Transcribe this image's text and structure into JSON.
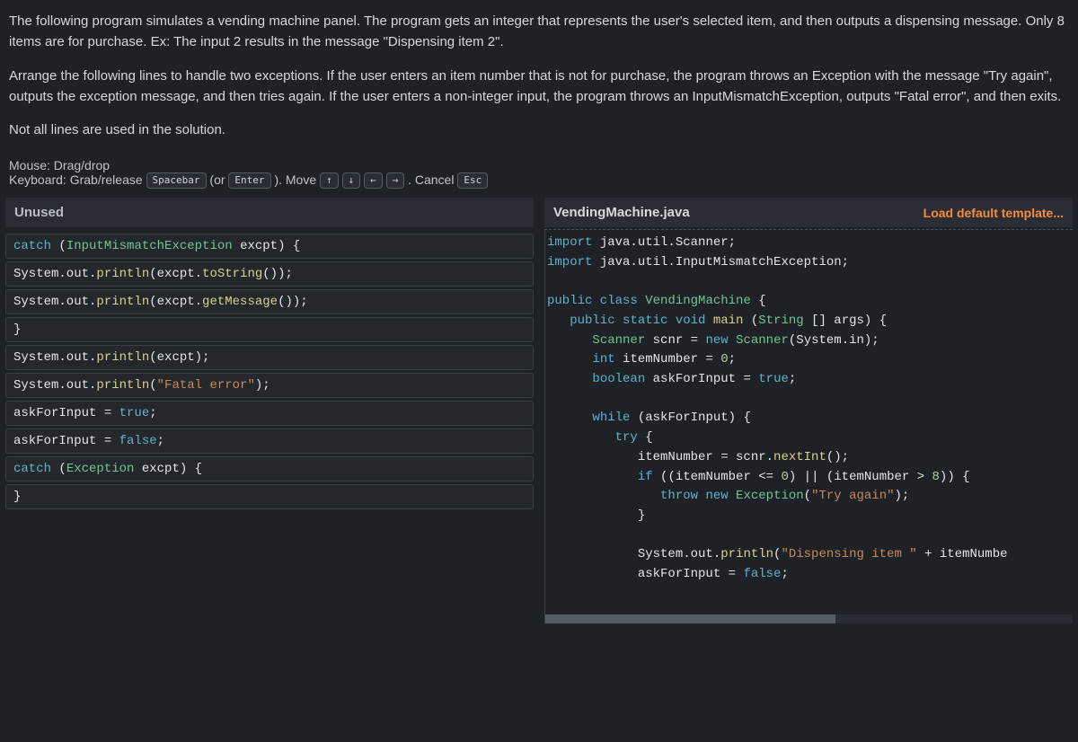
{
  "instructions": {
    "p1": "The following program simulates a vending machine panel. The program gets an integer that represents the user's selected item, and then outputs a dispensing message. Only 8 items are for purchase. Ex: The input 2 results in the message \"Dispensing item 2\".",
    "p2": "Arrange the following lines to handle two exceptions. If the user enters an item number that is not for purchase, the program throws an Exception with the message \"Try again\", outputs the exception message, and then tries again. If the user enters a non-integer input, the program throws an InputMismatchException, outputs \"Fatal error\", and then exits.",
    "p3": "Not all lines are used in the solution."
  },
  "controls": {
    "mouse_label": "Mouse: Drag/drop",
    "kb_prefix": "Keyboard: Grab/release",
    "spacebar": "Spacebar",
    "or": "(or",
    "enter": "Enter",
    "close_paren": ").",
    "move": "Move",
    "up": "↑",
    "down": "↓",
    "left": "←",
    "right": "→",
    "period": ".",
    "cancel": "Cancel",
    "esc": "Esc"
  },
  "left": {
    "title": "Unused",
    "blocks": [
      "catch (InputMismatchException excpt) {",
      "System.out.println(excpt.toString());",
      "System.out.println(excpt.getMessage());",
      "}",
      "System.out.println(excpt);",
      "System.out.println(\"Fatal error\");",
      "askForInput = true;",
      "askForInput = false;",
      "catch (Exception excpt) {",
      "}"
    ]
  },
  "right": {
    "filename": "VendingMachine.java",
    "load_link": "Load default template..."
  },
  "code": {
    "l1a": "import",
    "l1b": " java.util.Scanner;",
    "l2a": "import",
    "l2b": " java.util.InputMismatchException;",
    "l4a": "public class",
    "l4b": " VendingMachine",
    "l4c": " {",
    "l5a": "   public static void",
    "l5b": " main",
    "l5c": " (",
    "l5d": "String",
    "l5e": " [] args) {",
    "l6a": "      ",
    "l6b": "Scanner",
    "l6c": " scnr = ",
    "l6d": "new",
    "l6e": " Scanner",
    "l6f": "(System.in);",
    "l7a": "      ",
    "l7b": "int",
    "l7c": " itemNumber = ",
    "l7d": "0",
    "l7e": ";",
    "l8a": "      ",
    "l8b": "boolean",
    "l8c": " askForInput = ",
    "l8d": "true",
    "l8e": ";",
    "l10a": "      ",
    "l10b": "while",
    "l10c": " (askForInput) {",
    "l11a": "         ",
    "l11b": "try",
    "l11c": " {",
    "l12a": "            itemNumber = scnr.",
    "l12b": "nextInt",
    "l12c": "();",
    "l13a": "            ",
    "l13b": "if",
    "l13c": " ((itemNumber <= ",
    "l13d": "0",
    "l13e": ") || (itemNumber > ",
    "l13f": "8",
    "l13g": ")) {",
    "l14a": "               ",
    "l14b": "throw new",
    "l14c": " Exception",
    "l14d": "(",
    "l14e": "\"Try again\"",
    "l14f": ");",
    "l15a": "            }",
    "l17a": "            System.out.",
    "l17b": "println",
    "l17c": "(",
    "l17d": "\"Dispensing item \"",
    "l17e": " + itemNumbe",
    "l18a": "            askForInput = ",
    "l18b": "false",
    "l18c": ";"
  }
}
